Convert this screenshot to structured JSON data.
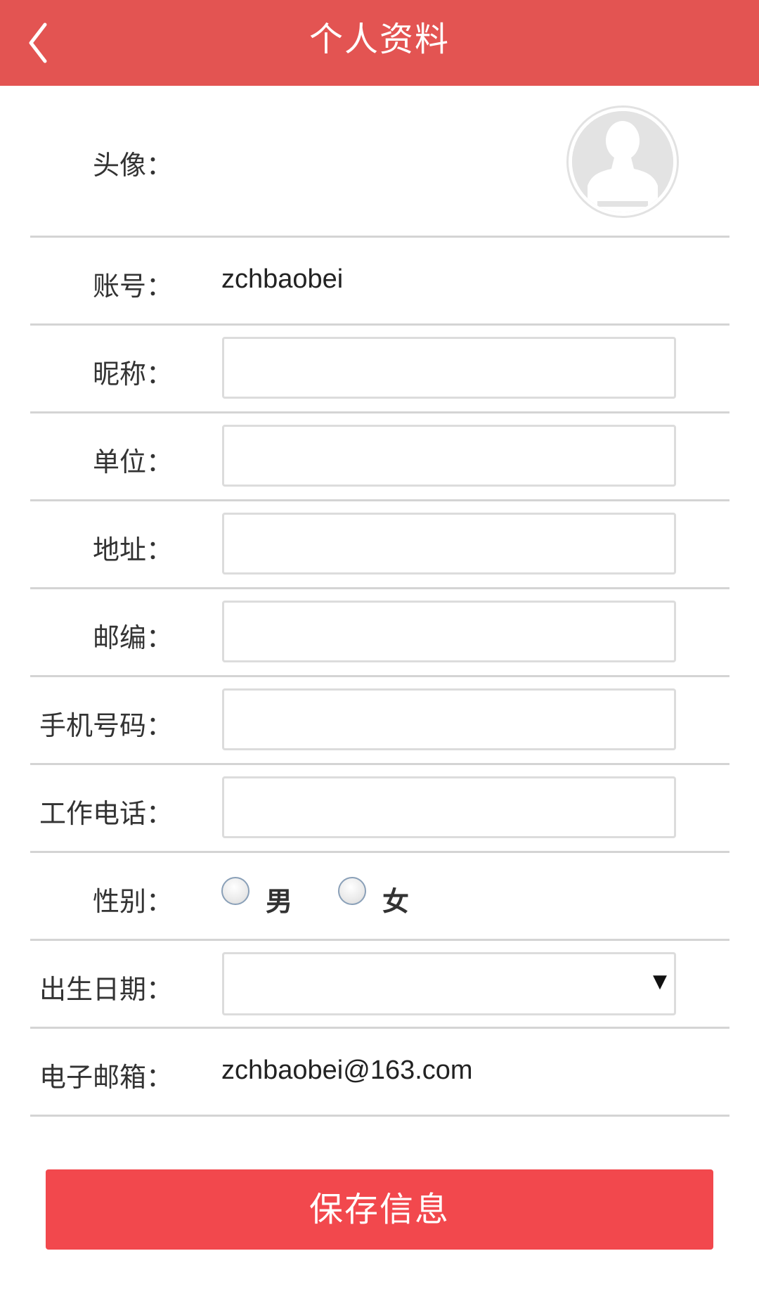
{
  "header": {
    "title": "个人资料",
    "back_icon": "chevron-left-icon"
  },
  "colors": {
    "header_bg": "#e35452",
    "button_bg": "#f2484d",
    "divider": "#d4d4d4"
  },
  "form": {
    "avatar_label": "头像：",
    "account_label": "账号：",
    "account_value": "zchbaobei",
    "nickname_label": "昵称：",
    "nickname_value": "",
    "company_label": "单位：",
    "company_value": "",
    "address_label": "地址：",
    "address_value": "",
    "postcode_label": "邮编：",
    "postcode_value": "",
    "mobile_label": "手机号码：",
    "mobile_value": "",
    "work_phone_label": "工作电话：",
    "work_phone_value": "",
    "gender_label": "性别：",
    "gender_options": [
      "男",
      "女"
    ],
    "birthday_label": "出生日期：",
    "birthday_value": "",
    "email_label": "电子邮箱：",
    "email_value": "zchbaobei@163.com"
  },
  "save_button": {
    "label": "保存信息"
  }
}
